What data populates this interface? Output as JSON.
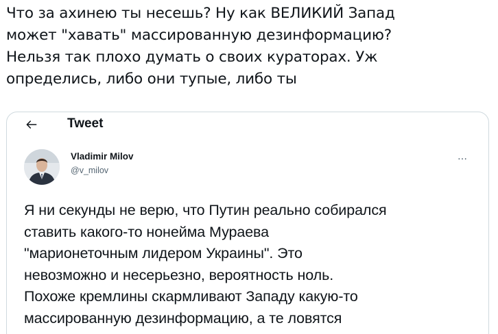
{
  "post": {
    "lines": [
      "Что за ахинею ты несешь? Ну как ВЕЛИКИЙ Запад",
      "может \"хавать\" массированную дезинформацию?",
      "Нельзя так плохо думать о своих кураторах. Уж",
      "определись, либо они тупые, либо ты"
    ]
  },
  "embed": {
    "header_title": "Tweet",
    "back_icon": "arrow-left-icon",
    "author": {
      "name": "Vladimir Milov",
      "handle": "@v_milov"
    },
    "more_icon": "more-horizontal-icon",
    "text_lines": [
      "Я ни секунды не верю, что Путин реально собирался",
      "ставить какого-то нонейма Мураева",
      "\"марионеточным лидером Украины\". Это",
      "невозможно и несерьезно, вероятность ноль.",
      "Похоже кремлины скармливают Западу какую-то",
      "массированную дезинформацию, а те ловятся"
    ]
  },
  "colors": {
    "text": "#0f1419",
    "secondary": "#536471",
    "border": "#cfd9de"
  }
}
